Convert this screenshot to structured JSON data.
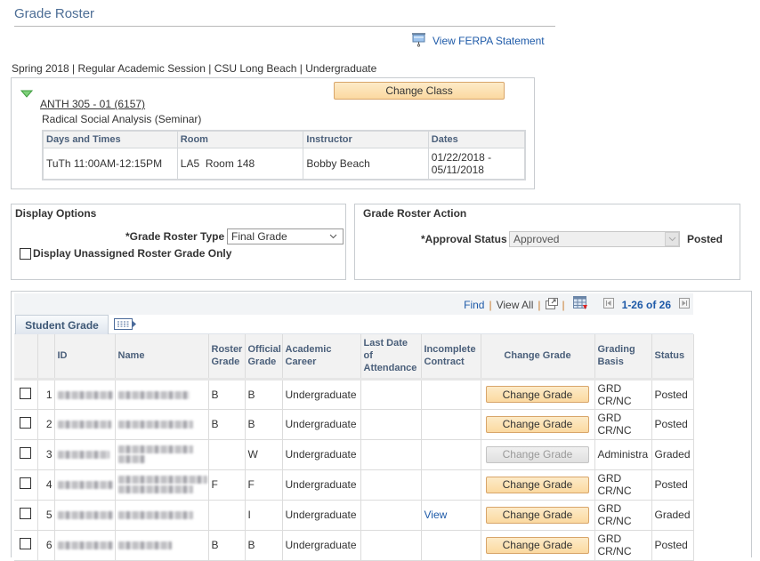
{
  "header": {
    "title": "Grade Roster",
    "ferpa_link": "View FERPA Statement",
    "context": "Spring 2018 | Regular Academic Session | CSU Long Beach | Undergraduate"
  },
  "class_info": {
    "change_class_label": "Change Class",
    "class_link": "ANTH 305 - 01 (6157)",
    "description": "Radical Social Analysis (Seminar)",
    "meeting_columns": [
      "Days and Times",
      "Room",
      "Instructor",
      "Dates"
    ],
    "meeting_row": {
      "days_times": "TuTh 11:00AM-12:15PM",
      "room": "LA5  Room 148",
      "instructor": "Bobby Beach",
      "dates": "01/22/2018 - 05/11/2018"
    }
  },
  "display_options": {
    "title": "Display Options",
    "roster_type_label": "*Grade Roster Type",
    "roster_type_value": "Final Grade",
    "unassigned_label": "Display Unassigned Roster Grade Only",
    "unassigned_checked": false
  },
  "roster_action": {
    "title": "Grade Roster Action",
    "approval_label": "*Approval Status",
    "approval_value": "Approved",
    "status_text": "Posted"
  },
  "grid": {
    "nav": {
      "find": "Find",
      "view_all": "View All",
      "sep": "|",
      "count": "1-26 of 26"
    },
    "tab_label": "Student Grade",
    "columns": {
      "select": "",
      "row_num": "",
      "id": "ID",
      "name": "Name",
      "roster_grade": "Roster Grade",
      "official_grade": "Official Grade",
      "academic_career": "Academic Career",
      "last_date": "Last Date of Attendance",
      "incomplete": "Incomplete Contract",
      "change_grade": "Change Grade",
      "grading_basis": "Grading Basis",
      "status": "Status"
    },
    "rows": [
      {
        "num": "1",
        "roster_grade": "B",
        "official_grade": "B",
        "career": "Undergraduate",
        "last_date": "",
        "incomplete": "",
        "change_label": "Change Grade",
        "change_enabled": true,
        "basis": "GRD CR/NC",
        "status": "Posted"
      },
      {
        "num": "2",
        "roster_grade": "B",
        "official_grade": "B",
        "career": "Undergraduate",
        "last_date": "",
        "incomplete": "",
        "change_label": "Change Grade",
        "change_enabled": true,
        "basis": "GRD CR/NC",
        "status": "Posted"
      },
      {
        "num": "3",
        "roster_grade": "",
        "official_grade": "W",
        "career": "Undergraduate",
        "last_date": "",
        "incomplete": "",
        "change_label": "Change Grade",
        "change_enabled": false,
        "basis": "Administra",
        "status": "Graded"
      },
      {
        "num": "4",
        "roster_grade": "F",
        "official_grade": "F",
        "career": "Undergraduate",
        "last_date": "",
        "incomplete": "",
        "change_label": "Change Grade",
        "change_enabled": true,
        "basis": "GRD CR/NC",
        "status": "Posted"
      },
      {
        "num": "5",
        "roster_grade": "",
        "official_grade": "I",
        "career": "Undergraduate",
        "last_date": "",
        "incomplete": "View",
        "change_label": "Change Grade",
        "change_enabled": true,
        "basis": "GRD CR/NC",
        "status": "Graded"
      },
      {
        "num": "6",
        "roster_grade": "B",
        "official_grade": "B",
        "career": "Undergraduate",
        "last_date": "",
        "incomplete": "",
        "change_label": "Change Grade",
        "change_enabled": true,
        "basis": "GRD CR/NC",
        "status": "Posted"
      }
    ]
  },
  "colors": {
    "title_blue": "#4c6d95",
    "link_blue": "#1e5aa8",
    "header_text": "#4a5f7a",
    "button_orange": "#fbd9a0"
  }
}
